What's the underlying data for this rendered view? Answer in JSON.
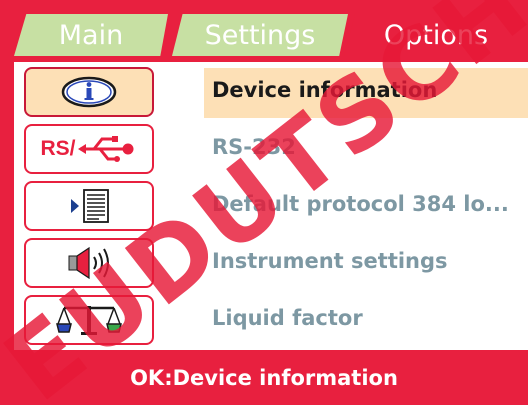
{
  "tabs": [
    {
      "label": "Main",
      "active": false
    },
    {
      "label": "Settings",
      "active": false
    },
    {
      "label": "Options",
      "active": true
    }
  ],
  "menu": {
    "items": [
      {
        "label": "Device information",
        "icon": "info-icon",
        "selected": true
      },
      {
        "label": "RS-232",
        "icon": "rs232-usb-icon",
        "selected": false
      },
      {
        "label": "Default protocol 384 lo...",
        "icon": "protocol-list-icon",
        "selected": false
      },
      {
        "label": "Instrument settings",
        "icon": "speaker-icon",
        "selected": false
      },
      {
        "label": "Liquid factor",
        "icon": "balance-scale-icon",
        "selected": false
      }
    ],
    "rs_label": "RS/"
  },
  "footer": {
    "text": "OK:Device information"
  },
  "watermark": {
    "text": "EUDUTSCH"
  },
  "colors": {
    "frame": "#e8203f",
    "tab_inactive": "#c7e0a3",
    "selection": "#fde0b6",
    "item_text": "#7d98a3"
  }
}
